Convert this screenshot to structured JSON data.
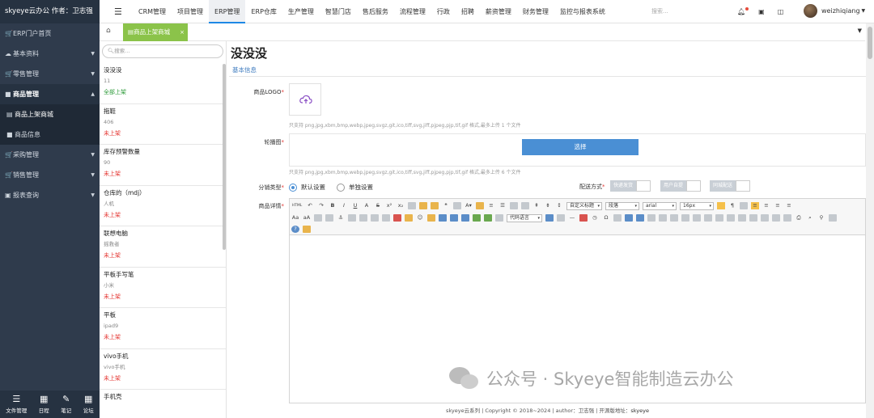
{
  "sidebar": {
    "title": "skyeye云办公 作者：卫志强",
    "items": [
      {
        "label": "ERP门户首页",
        "icon": "cart-icon"
      },
      {
        "label": "基本资料",
        "icon": "cloud-icon"
      },
      {
        "label": "零售管理",
        "icon": "cart-icon"
      },
      {
        "label": "商品管理",
        "icon": "box-icon"
      },
      {
        "label": "商品上架商城",
        "icon": "doc-icon"
      },
      {
        "label": "商品信息",
        "icon": "box-icon"
      },
      {
        "label": "采购管理",
        "icon": "cart-icon"
      },
      {
        "label": "销售管理",
        "icon": "cart-icon"
      },
      {
        "label": "报表查询",
        "icon": "report-icon"
      }
    ],
    "bottom": [
      {
        "label": "文件管理",
        "icon": "list-icon"
      },
      {
        "label": "日程",
        "icon": "calendar-icon"
      },
      {
        "label": "笔记",
        "icon": "pen-icon"
      },
      {
        "label": "论坛",
        "icon": "calendar-icon"
      }
    ]
  },
  "topbar": {
    "menu": [
      "CRM管理",
      "项目管理",
      "ERP管理",
      "ERP仓库",
      "生产管理",
      "智慧门店",
      "售后服务",
      "流程管理",
      "行政",
      "招聘",
      "薪资管理",
      "财务管理",
      "监控与报表系统"
    ],
    "active": "ERP管理",
    "search_placeholder": "搜索...",
    "username": "weizhiqiang"
  },
  "tabs": {
    "open_tab": "商品上架商城"
  },
  "list": {
    "search_placeholder": "搜索...",
    "items": [
      {
        "name": "没没没",
        "desc": "11",
        "status": "全部上架",
        "state": "on"
      },
      {
        "name": "拖鞋",
        "desc": "406",
        "status": "未上架",
        "state": "off"
      },
      {
        "name": "库存预警数量",
        "desc": "90",
        "status": "未上架",
        "state": "off"
      },
      {
        "name": "仓库的（mdj）",
        "desc": "人机",
        "status": "未上架",
        "state": "off"
      },
      {
        "name": "联想电脑",
        "desc": "摇救者",
        "status": "未上架",
        "state": "off"
      },
      {
        "name": "平板手写笔",
        "desc": "小米",
        "status": "未上架",
        "state": "off"
      },
      {
        "name": "平板",
        "desc": "ipad9",
        "status": "未上架",
        "state": "off"
      },
      {
        "name": "vivo手机",
        "desc": "vivo手机",
        "status": "未上架",
        "state": "off"
      },
      {
        "name": "手机壳",
        "desc": "",
        "status": "",
        "state": "off"
      }
    ]
  },
  "form": {
    "title": "没没没",
    "section": "基本信息",
    "logo_label": "商品LOGO",
    "logo_hint": "只支持 png,jpg,xbm,bmp,webp,jpeg,svgz,git,ico,tiff,svg,jiff,pjpeg,pjp,tif,gif 格式,最多上传 1 个文件",
    "carousel_label": "轮播图",
    "choose_label": "选择",
    "carousel_hint": "只支持 png,jpg,xbm,bmp,webp,jpeg,svgz,git,ico,tiff,svg,jiff,pjpeg,pjp,tif,gif 格式,最多上传 6 个文件",
    "dist_label": "分销类型",
    "dist_options": [
      "默认设置",
      "单独设置"
    ],
    "dist_selected": "默认设置",
    "delivery_label": "配送方式",
    "delivery_options": [
      "快递发货",
      "用户自提",
      "同城配送"
    ],
    "detail_label": "商品详情",
    "editor": {
      "paragraph_format": "自定义标题",
      "paragraph": "段落",
      "font_family": "arial",
      "font_size": "16px",
      "code_lang": "代码语言",
      "source_label": "HTML"
    }
  },
  "footer": {
    "text": "skyeye云系列 | Copyright © 2018~2024 | author：卫志强 | 开源版地址：",
    "link": "skyeye"
  },
  "watermark": {
    "text": "公众号 · Skyeye智能制造云办公"
  }
}
